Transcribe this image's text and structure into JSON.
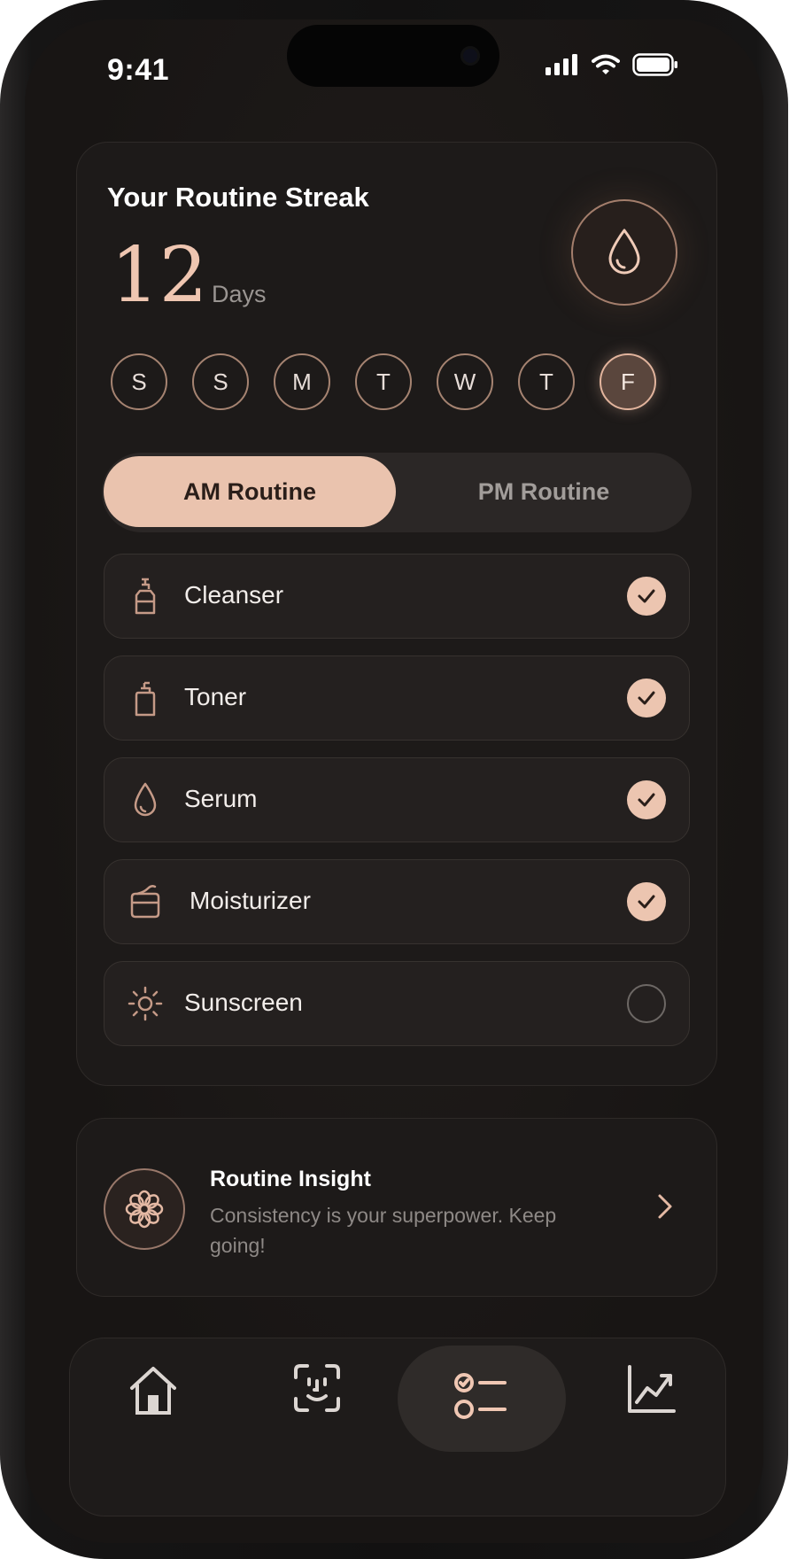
{
  "status": {
    "time": "9:41"
  },
  "streak": {
    "title": "Your Routine Streak",
    "count": "12",
    "unit": "Days",
    "days": [
      {
        "letter": "S",
        "active": false
      },
      {
        "letter": "S",
        "active": false
      },
      {
        "letter": "M",
        "active": false
      },
      {
        "letter": "T",
        "active": false
      },
      {
        "letter": "W",
        "active": false
      },
      {
        "letter": "T",
        "active": false
      },
      {
        "letter": "F",
        "active": true
      }
    ]
  },
  "routine_toggle": {
    "am_label": "AM Routine",
    "pm_label": "PM Routine",
    "selected": "am"
  },
  "steps": [
    {
      "label": "Cleanser",
      "icon": "pump-bottle-icon",
      "done": true
    },
    {
      "label": "Toner",
      "icon": "spray-bottle-icon",
      "done": true
    },
    {
      "label": "Serum",
      "icon": "droplet-icon",
      "done": true
    },
    {
      "label": "Moisturizer",
      "icon": "cream-jar-icon",
      "done": true
    },
    {
      "label": "Sunscreen",
      "icon": "sun-icon",
      "done": false
    }
  ],
  "insight": {
    "title": "Routine Insight",
    "body": "Consistency is your superpower. Keep going!",
    "icon": "flower-icon"
  },
  "tabs": [
    {
      "icon": "home-icon",
      "active": false
    },
    {
      "icon": "face-scan-icon",
      "active": false
    },
    {
      "icon": "checklist-icon",
      "active": true
    },
    {
      "icon": "trend-chart-icon",
      "active": false
    }
  ],
  "colors": {
    "accent": "#eac3ae",
    "accent_stroke": "#c9a08c",
    "background": "#1a1716"
  }
}
